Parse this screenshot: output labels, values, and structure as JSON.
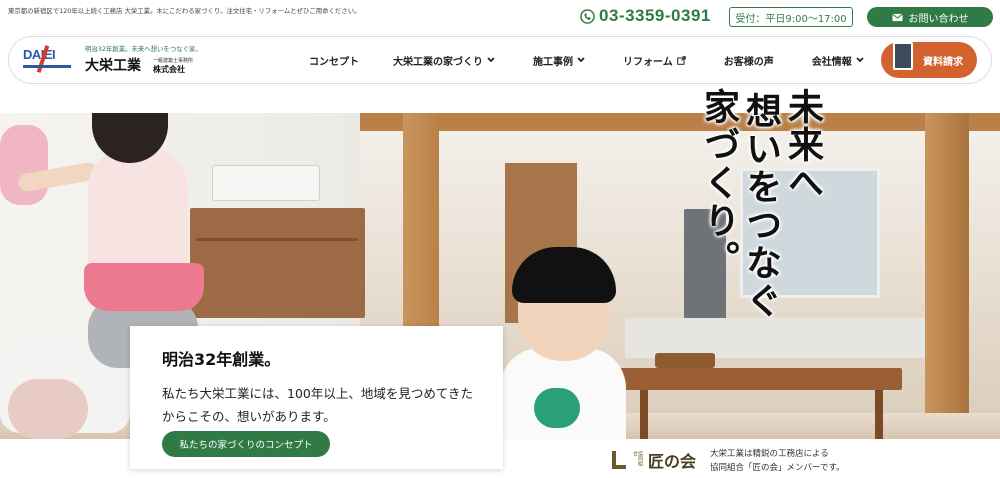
{
  "topbar": {
    "tagline": "東京都の新宿区で120年以上続く工務店 大栄工業。木にこだわる家づくり。注文住宅・リフォームとぜひご用命ください。",
    "phone": "03-3359-0391",
    "hours": "受付：平日9:00〜17:00",
    "contact_label": "お問い合わせ"
  },
  "logo": {
    "mark_text": "DAIEI",
    "catch": "明治32年創業。未来へ想いをつなぐ家。",
    "name": "大栄工業",
    "sub1": "一級建築士事務所",
    "sub2": "株式会社"
  },
  "nav": {
    "items": [
      {
        "label": "コンセプト"
      },
      {
        "label": "大栄工業の家づくり"
      },
      {
        "label": "施工事例"
      },
      {
        "label": "リフォーム"
      },
      {
        "label": "お客様の声"
      },
      {
        "label": "会社情報"
      }
    ],
    "request_label": "資料請求"
  },
  "hero": {
    "catch_lines": [
      "未来へ",
      "想いをつなぐ",
      "家づくり。"
    ]
  },
  "card": {
    "title": "明治32年創業。",
    "body": "私たち大栄工業には、100年以上、地域を見つめてきたからこその、想いがあります。",
    "button_label": "私たちの家づくりのコンセプト"
  },
  "footer": {
    "takumi_small": "協同組合",
    "takumi_name": "匠の会",
    "member_line1": "大栄工業は精鋭の工務店による",
    "member_line2": "協同組合「匠の会」メンバーです。"
  },
  "colors": {
    "brand_green": "#2f7a45",
    "request_orange": "#d2622e"
  },
  "icons": [
    "phone-icon",
    "mail-icon",
    "chevron-down-icon",
    "external-link-icon",
    "book-icon"
  ]
}
